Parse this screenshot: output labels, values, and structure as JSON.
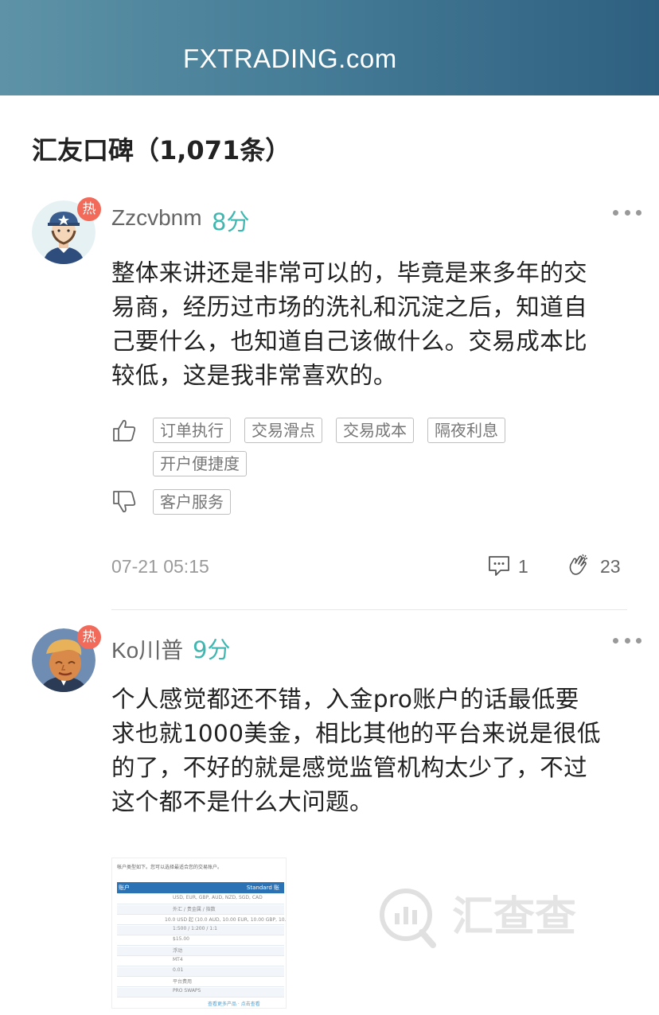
{
  "header": {
    "brand": "FXTRADING.com"
  },
  "section": {
    "title": "汇友口碑（1,071条）"
  },
  "reviews": [
    {
      "badge": "热",
      "username": "Zzcvbnm",
      "score": "8分",
      "content_lines": [
        "整体来讲还是非常可以的，毕竟是来多年的交",
        "易商，经历过市场的洗礼和沉淀之后，知道自",
        "己要什么，也知道自己该做什么。交易成本比",
        "较低，这是我非常喜欢的。"
      ],
      "positive_tags": [
        "订单执行",
        "交易滑点",
        "交易成本",
        "隔夜利息",
        "开户便捷度"
      ],
      "negative_tags": [
        "客户服务"
      ],
      "date": "07-21 05:15",
      "comments": "1",
      "likes": "23",
      "icons": {
        "avatar": "avatar-cartoon-man-icon",
        "like": "thumbs-up-icon",
        "dislike": "thumbs-down-icon",
        "comment": "comment-bubble-icon",
        "clap": "clapping-hands-icon",
        "more": "more-dots-icon"
      }
    },
    {
      "badge": "热",
      "username": "Ko川普",
      "score": "9分",
      "content_lines": [
        "个人感觉都还不错，入金pro账户的话最低要",
        "求也就1000美金，相比其他的平台来说是很低",
        "的了，不好的就是感觉监管机构太少了，不过",
        "这个都不是什么大问题。"
      ],
      "icons": {
        "avatar": "avatar-portrait-icon",
        "more": "more-dots-icon"
      },
      "attachment": {
        "caption": "帐户类型如下。您可以选择最适合您的交易账户。",
        "header_left": "账户",
        "header_right": "Standard 账",
        "rows": [
          "USD, EUR, GBP, AUD, NZD, SGD, CAD",
          "外汇 / 贵金属 / 指数",
          "10.0 USD 起 (10.0 AUD, 10.00 EUR, 10.00 GBP, 10.00 SGD)",
          "1:500 / 1:200 / 1:1",
          "$15.00",
          "浮动",
          "MT4",
          "0.01",
          "平台费用",
          "PRO SWAPS"
        ],
        "link": "查看更多产品 · 点击查看"
      }
    }
  ],
  "watermark": {
    "text": "汇查查"
  }
}
